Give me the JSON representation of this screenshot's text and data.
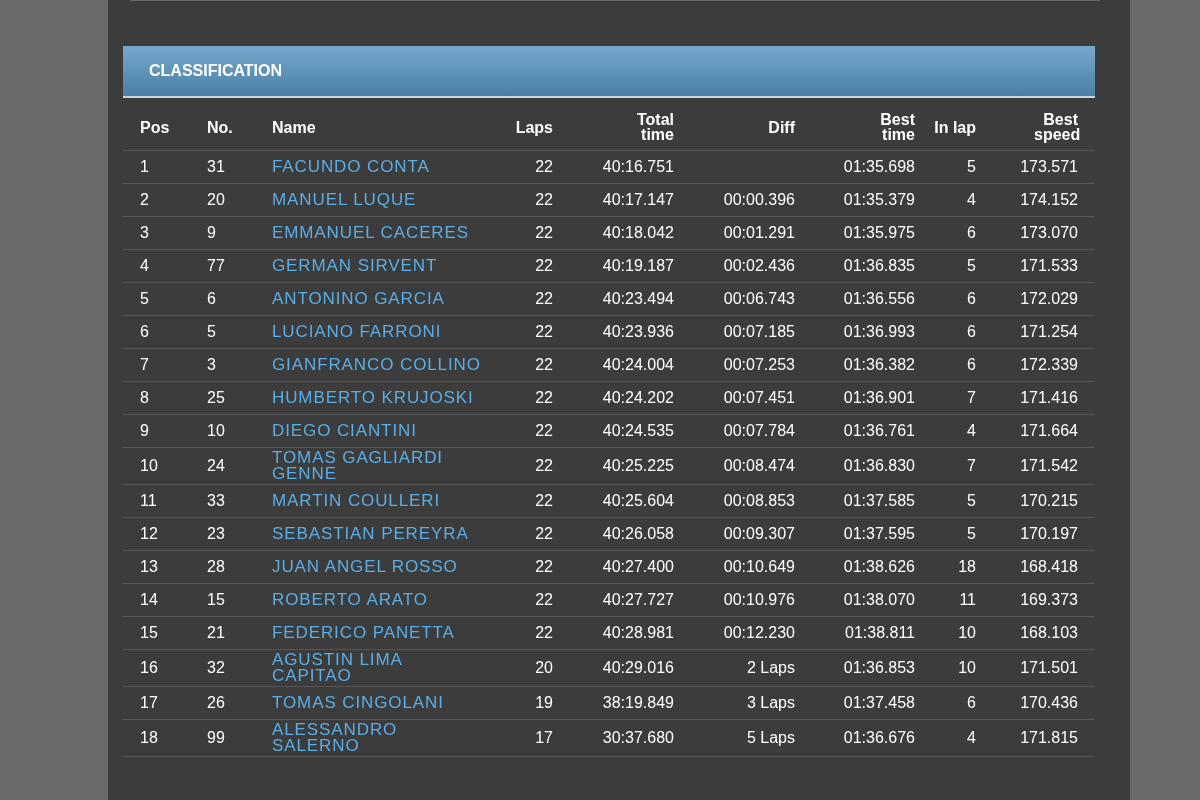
{
  "panel": {
    "title": "CLASSIFICATION"
  },
  "table": {
    "columns": [
      "Pos",
      "No.",
      "Name",
      "Laps",
      "Total time",
      "Diff",
      "Best time",
      "In lap",
      "Best speed"
    ],
    "rows": [
      [
        "1",
        "31",
        "FACUNDO CONTA",
        "22",
        "40:16.751",
        "",
        "01:35.698",
        "5",
        "173.571"
      ],
      [
        "2",
        "20",
        "MANUEL LUQUE",
        "22",
        "40:17.147",
        "00:00.396",
        "01:35.379",
        "4",
        "174.152"
      ],
      [
        "3",
        "9",
        "EMMANUEL CACERES",
        "22",
        "40:18.042",
        "00:01.291",
        "01:35.975",
        "6",
        "173.070"
      ],
      [
        "4",
        "77",
        "GERMAN SIRVENT",
        "22",
        "40:19.187",
        "00:02.436",
        "01:36.835",
        "5",
        "171.533"
      ],
      [
        "5",
        "6",
        "ANTONINO GARCIA",
        "22",
        "40:23.494",
        "00:06.743",
        "01:36.556",
        "6",
        "172.029"
      ],
      [
        "6",
        "5",
        "LUCIANO FARRONI",
        "22",
        "40:23.936",
        "00:07.185",
        "01:36.993",
        "6",
        "171.254"
      ],
      [
        "7",
        "3",
        "GIANFRANCO COLLINO",
        "22",
        "40:24.004",
        "00:07.253",
        "01:36.382",
        "6",
        "172.339"
      ],
      [
        "8",
        "25",
        "HUMBERTO KRUJOSKI",
        "22",
        "40:24.202",
        "00:07.451",
        "01:36.901",
        "7",
        "171.416"
      ],
      [
        "9",
        "10",
        "DIEGO CIANTINI",
        "22",
        "40:24.535",
        "00:07.784",
        "01:36.761",
        "4",
        "171.664"
      ],
      [
        "10",
        "24",
        "TOMAS GAGLIARDI GENNE",
        "22",
        "40:25.225",
        "00:08.474",
        "01:36.830",
        "7",
        "171.542"
      ],
      [
        "11",
        "33",
        "MARTIN COULLERI",
        "22",
        "40:25.604",
        "00:08.853",
        "01:37.585",
        "5",
        "170.215"
      ],
      [
        "12",
        "23",
        "SEBASTIAN PEREYRA",
        "22",
        "40:26.058",
        "00:09.307",
        "01:37.595",
        "5",
        "170.197"
      ],
      [
        "13",
        "28",
        "JUAN ANGEL ROSSO",
        "22",
        "40:27.400",
        "00:10.649",
        "01:38.626",
        "18",
        "168.418"
      ],
      [
        "14",
        "15",
        "ROBERTO ARATO",
        "22",
        "40:27.727",
        "00:10.976",
        "01:38.070",
        "11",
        "169.373"
      ],
      [
        "15",
        "21",
        "FEDERICO PANETTA",
        "22",
        "40:28.981",
        "00:12.230",
        "01:38.811",
        "10",
        "168.103"
      ],
      [
        "16",
        "32",
        "AGUSTIN LIMA CAPITAO",
        "20",
        "40:29.016",
        "2 Laps",
        "01:36.853",
        "10",
        "171.501"
      ],
      [
        "17",
        "26",
        "TOMAS CINGOLANI",
        "19",
        "38:19.849",
        "3 Laps",
        "01:37.458",
        "6",
        "170.436"
      ],
      [
        "18",
        "99",
        "ALESSANDRO SALERNO",
        "17",
        "30:37.680",
        "5 Laps",
        "01:36.676",
        "4",
        "171.815"
      ]
    ]
  }
}
